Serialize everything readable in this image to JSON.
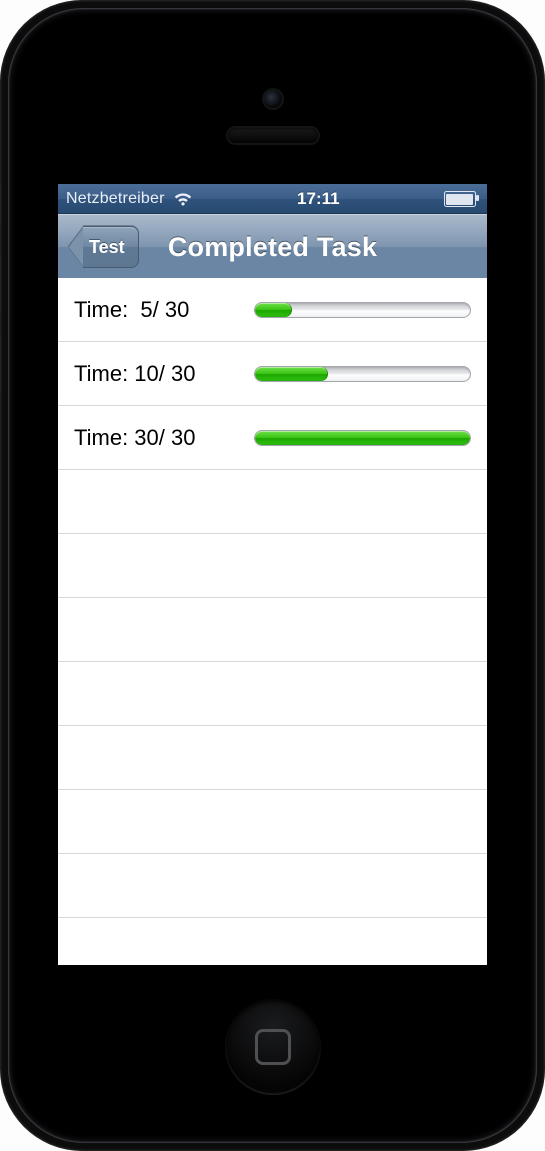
{
  "statusBar": {
    "carrier": "Netzbetreiber",
    "time": "17:11",
    "wifiIcon": "wifi-icon",
    "batteryIcon": "battery-icon"
  },
  "navBar": {
    "backLabel": "Test",
    "title": "Completed Task"
  },
  "rows": [
    {
      "label": "Time:  5/ 30",
      "value": 5,
      "max": 30
    },
    {
      "label": "Time: 10/ 30",
      "value": 10,
      "max": 30
    },
    {
      "label": "Time: 30/ 30",
      "value": 30,
      "max": 30
    }
  ],
  "emptyRows": 10,
  "colors": {
    "progressGreen": "#2fc213",
    "navGradientTop": "#a9b9cb",
    "navGradientBottom": "#6b86a4"
  }
}
